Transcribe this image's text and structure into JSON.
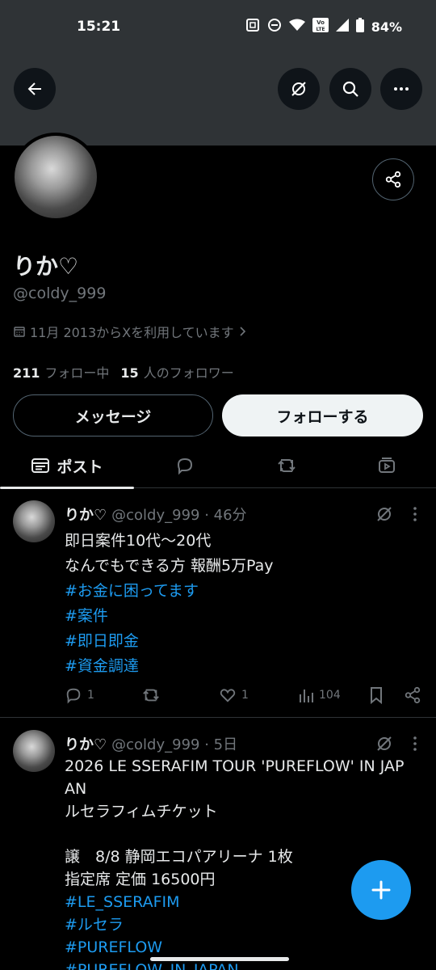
{
  "status_bar": {
    "time": "15:21",
    "battery": "84%"
  },
  "profile": {
    "display_name": "りか♡",
    "handle": "@coldy_999",
    "joined": "11月 2013からXを利用しています",
    "following_count": "211",
    "following_label": "フォロー中",
    "followers_count": "15",
    "followers_label": "人のフォロワー",
    "message_label": "メッセージ",
    "follow_label": "フォローする"
  },
  "tabs": {
    "posts_label": "ポスト"
  },
  "posts": [
    {
      "name": "りか♡",
      "meta": "@coldy_999 · 46分",
      "lines": [
        "即日案件10代〜20代",
        "なんでもできる方 報酬5万Pay"
      ],
      "hashtags": [
        "#お金に困ってます",
        "#案件",
        "#即日即金",
        "#資金調達"
      ],
      "replies": "1",
      "reposts": "",
      "likes": "1",
      "views": "104"
    },
    {
      "name": "りか♡",
      "meta": "@coldy_999 · 5日",
      "lines": [
        "2026 LE SSERAFIM TOUR 'PUREFLOW' IN JAP",
        "AN",
        "ルセラフィムチケット",
        "",
        "譲　8/8 静岡エコパアリーナ 1枚",
        "指定席 定価 16500円"
      ],
      "hashtags": [
        "#LE_SSERAFIM",
        "#ルセラ",
        "#PUREFLOW",
        "#PUREFLOW_IN_JAPAN"
      ]
    }
  ],
  "colors": {
    "accent": "#1d9bf0",
    "background": "#000000",
    "banner": "#2f3336",
    "muted": "#71767b"
  }
}
